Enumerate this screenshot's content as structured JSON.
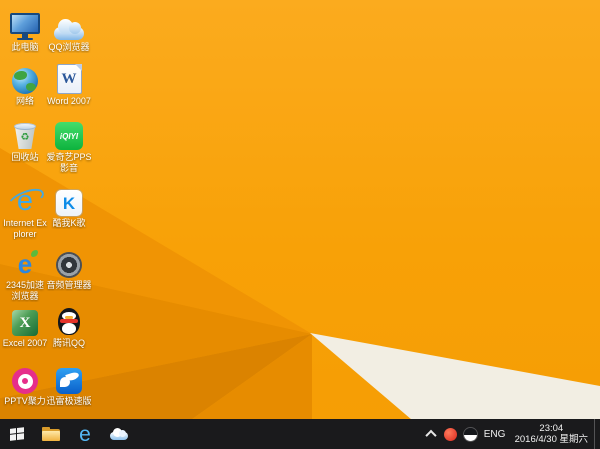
{
  "wallpaper": {
    "base_color": "#F8A008",
    "facet_colors": [
      "#F09404",
      "#E78C00",
      "#DB8300",
      "#E78C00",
      "#F2EEE3"
    ]
  },
  "desktop_icons": [
    {
      "id": "this-pc",
      "label": "此电脑"
    },
    {
      "id": "qq-browser",
      "label": "QQ浏览器"
    },
    {
      "id": "network",
      "label": "网络"
    },
    {
      "id": "word-2007",
      "label": "Word 2007"
    },
    {
      "id": "recycle-bin",
      "label": "回收站"
    },
    {
      "id": "iqiyi-pps",
      "label": "爱奇艺PPS影音"
    },
    {
      "id": "internet-explorer",
      "label": "Internet Explorer"
    },
    {
      "id": "kuwo-ksing",
      "label": "酷我K歌"
    },
    {
      "id": "2345-browser",
      "label": "2345加速浏览器"
    },
    {
      "id": "audio-manager",
      "label": "音频管理器"
    },
    {
      "id": "excel-2007",
      "label": "Excel 2007"
    },
    {
      "id": "tencent-qq",
      "label": "腾讯QQ"
    },
    {
      "id": "pptv",
      "label": "PPTV聚力"
    },
    {
      "id": "xunlei",
      "label": "迅雷极速版"
    }
  ],
  "icon_glyphs": {
    "word": "W",
    "excel": "X",
    "kuwo": "K",
    "ie": "e",
    "e2345": "e",
    "iqiyi": "iQIYI",
    "recycle": "♻"
  },
  "taskbar": {
    "tray": {
      "language": "ENG",
      "time": "23:04",
      "date": "2016/4/30 星期六"
    }
  }
}
